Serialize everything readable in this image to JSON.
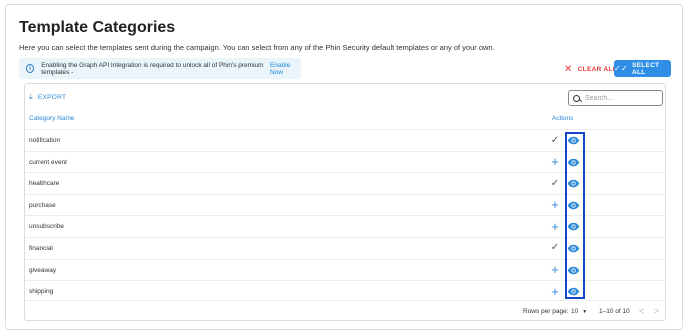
{
  "page": {
    "title": "Template Categories",
    "subtitle": "Here you can select the templates sent during the campaign. You can select from any of the Phin Security default templates or any of your own."
  },
  "banner": {
    "text": "Enabling the Graph API Integration is required to unlock all of Phin's premium templates -",
    "link": "Enable Now",
    "icon": "info-icon"
  },
  "toolbar": {
    "clear_all": "CLEAR ALL",
    "select_all": "SELECT ALL"
  },
  "table": {
    "export_label": "EXPORT",
    "search_placeholder": "Search…",
    "columns": {
      "name": "Category Name",
      "actions": "Actions"
    },
    "rows": [
      {
        "name": "notification",
        "selected": true
      },
      {
        "name": "current event",
        "selected": false
      },
      {
        "name": "healthcare",
        "selected": true
      },
      {
        "name": "purchase",
        "selected": false
      },
      {
        "name": "unsubscribe",
        "selected": false
      },
      {
        "name": "financial",
        "selected": true
      },
      {
        "name": "giveaway",
        "selected": false
      },
      {
        "name": "shipping",
        "selected": false
      }
    ],
    "footer": {
      "rows_per_page_label": "Rows per page:",
      "rows_per_page_value": "10",
      "range": "1–10 of 10"
    }
  },
  "colors": {
    "accent": "#2f8fe6",
    "danger": "#e53935",
    "highlight_box": "#1447c8"
  }
}
